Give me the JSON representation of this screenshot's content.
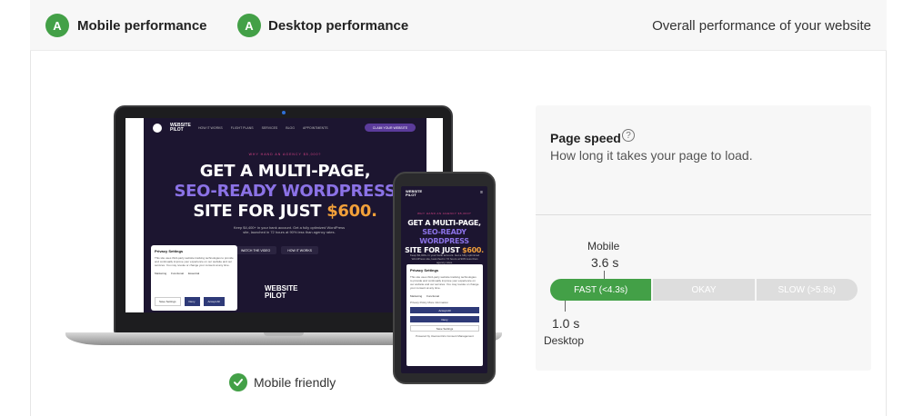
{
  "header": {
    "mobile": {
      "grade": "A",
      "label": "Mobile performance"
    },
    "desktop": {
      "grade": "A",
      "label": "Desktop performance"
    },
    "overall": "Overall performance of your website"
  },
  "preview": {
    "site_logo": "WEBSITE PILOT",
    "nav": [
      "HOW IT WORKS",
      "FLIGHT PLANS",
      "SERVICES",
      "BLOG",
      "APPOINTMENTS"
    ],
    "claim_button": "CLAIM YOUR WEBSITE",
    "eyebrow": "WHY HAND AN AGENCY $5,000?",
    "hero_line1": "GET A MULTI-PAGE,",
    "hero_line2": "SEO-READY WORDPRESS",
    "hero_line3a": "SITE FOR JUST ",
    "hero_price": "$600.",
    "hero_sub": "Keep $4,400+ in your bank account. Get a fully optimized WordPress site, launched in 72 hours at 90% less than agency rates.",
    "btn_watch": "WATCH THE VIDEO",
    "btn_how": "HOW IT WORKS",
    "privacy": {
      "title": "Privacy Settings",
      "text": "This site uses third-party website tracking technologies to provide and continually improve your experience on our website and our services. You may revoke or change your consent at any time.",
      "marketing": "Marketing",
      "functional": "Functional",
      "essential": "Essential",
      "links": "Privacy Policy  More information",
      "powered": "Powered by Usercentrics Consent Management",
      "save": "Save Settings",
      "deny": "Deny",
      "accept": "Accept All"
    }
  },
  "mobile_friendly": {
    "label": "Mobile friendly",
    "icon": "check-icon"
  },
  "page_speed": {
    "title": "Page speed",
    "description": "How long it takes your page to load.",
    "segments": [
      "FAST (<4.3s)",
      "OKAY",
      "SLOW (>5.8s)"
    ],
    "mobile_label": "Mobile",
    "mobile_value": "3.6 s",
    "desktop_label": "Desktop",
    "desktop_value": "1.0 s"
  },
  "colors": {
    "accent_green": "#43a047",
    "panel_bg": "#f7f7f7"
  }
}
